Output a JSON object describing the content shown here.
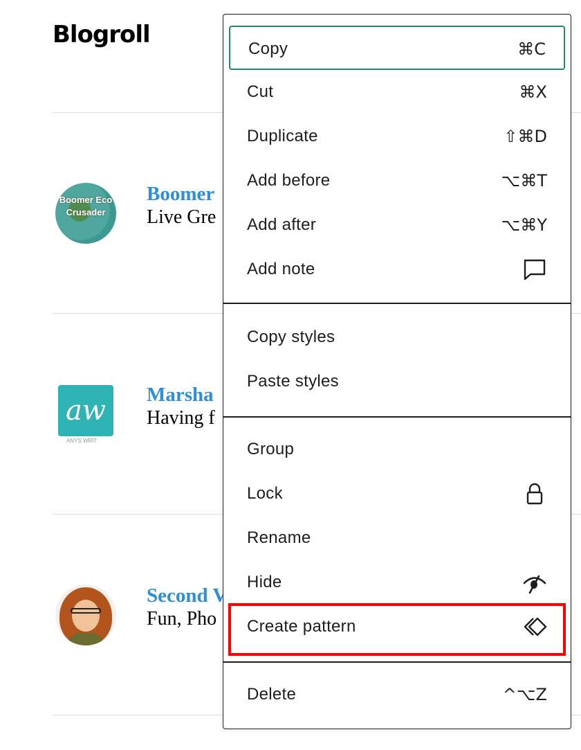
{
  "background": {
    "title": "Blogroll",
    "entries": [
      {
        "avatar_text": "Boomer Eco Crusader",
        "title": "Boomer",
        "desc": "Live Gre"
      },
      {
        "avatar_text": "",
        "title": "Marsha",
        "desc": "Having f"
      },
      {
        "avatar_text": "",
        "title": "Second V",
        "desc": "Fun, Pho"
      }
    ]
  },
  "menu": {
    "groups": [
      {
        "items": [
          {
            "label": "Copy",
            "shortcut": "⌘C"
          },
          {
            "label": "Cut",
            "shortcut": "⌘X"
          },
          {
            "label": "Duplicate",
            "shortcut": "⇧⌘D"
          },
          {
            "label": "Add before",
            "shortcut": "⌥⌘T"
          },
          {
            "label": "Add after",
            "shortcut": "⌥⌘Y"
          },
          {
            "label": "Add note",
            "icon": "comment-icon"
          }
        ]
      },
      {
        "items": [
          {
            "label": "Copy styles"
          },
          {
            "label": "Paste styles"
          }
        ]
      },
      {
        "items": [
          {
            "label": "Group"
          },
          {
            "label": "Lock",
            "icon": "lock-icon"
          },
          {
            "label": "Rename"
          },
          {
            "label": "Hide",
            "icon": "eye-slash-icon"
          },
          {
            "label": "Create pattern",
            "icon": "pattern-icon"
          }
        ]
      },
      {
        "items": [
          {
            "label": "Delete",
            "shortcut": "^⌥Z"
          }
        ]
      }
    ]
  },
  "colors": {
    "focus_ring": "#1f8a70",
    "highlight": "#ff0000",
    "link_blue": "#2f8ed8"
  }
}
